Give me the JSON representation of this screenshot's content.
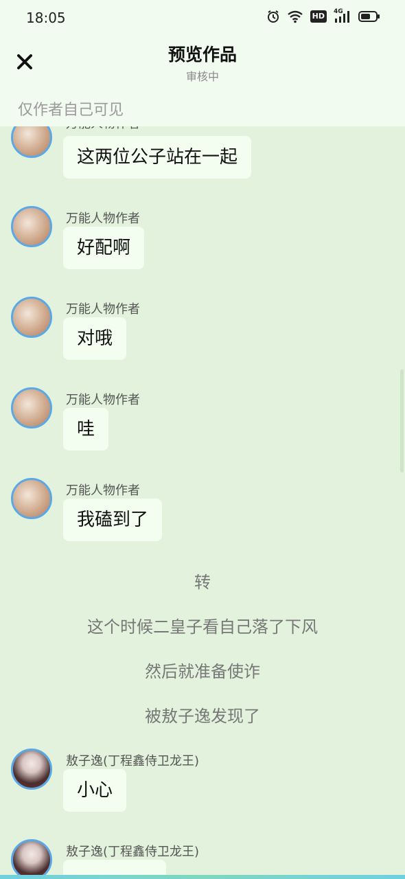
{
  "status_bar": {
    "time": "18:05",
    "icons": [
      "alarm-icon",
      "wifi-icon",
      "hd-icon",
      "4g-signal-icon",
      "battery-icon"
    ],
    "hd_label": "HD",
    "network_label": "4G"
  },
  "header": {
    "title": "预览作品",
    "subtitle": "审核中",
    "visibility_note": "仅作者自己可见"
  },
  "messages": [
    {
      "sender": "万能人物作者",
      "text": "这两位公子站在一起",
      "avatar": "warm"
    },
    {
      "sender": "万能人物作者",
      "text": "好配啊",
      "avatar": "warm"
    },
    {
      "sender": "万能人物作者",
      "text": "对哦",
      "avatar": "warm"
    },
    {
      "sender": "万能人物作者",
      "text": "哇",
      "avatar": "warm"
    },
    {
      "sender": "万能人物作者",
      "text": "我磕到了",
      "avatar": "warm"
    }
  ],
  "narrations": [
    "转",
    "这个时候二皇子看自己落了下风",
    "然后就准备使诈",
    "被敖子逸发现了"
  ],
  "messages_after": [
    {
      "sender": "敖子逸(丁程鑫侍卫龙王)",
      "text": "小心",
      "avatar": "dark"
    },
    {
      "sender": "敖子逸(丁程鑫侍卫龙王)",
      "text": "",
      "avatar": "dark"
    }
  ],
  "colors": {
    "background": "#e3f2dc",
    "header_bg": "#f1fbf0",
    "bubble_bg": "#f3fdf0",
    "avatar_border": "#5aa9e6"
  }
}
